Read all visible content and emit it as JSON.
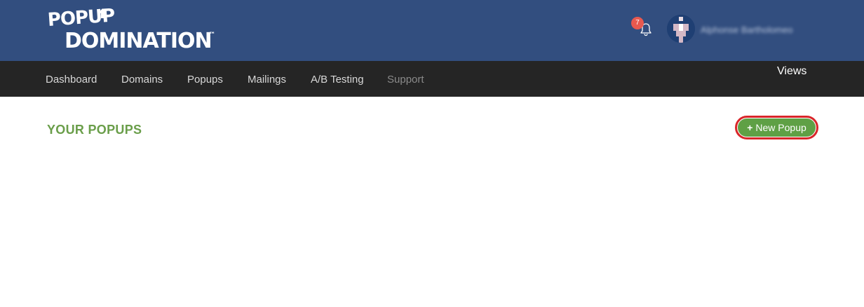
{
  "header": {
    "logo_line1": "POPUP",
    "logo_line2": "DOMINATION",
    "logo_tm": "™",
    "notification_count": "7",
    "user_name": "Alphonse Bartholomeo"
  },
  "nav": {
    "items": [
      {
        "label": "Dashboard"
      },
      {
        "label": "Domains"
      },
      {
        "label": "Popups"
      },
      {
        "label": "Mailings"
      },
      {
        "label": "A/B Testing"
      },
      {
        "label": "Support"
      }
    ],
    "views_label": "Views"
  },
  "main": {
    "title": "YOUR POPUPS",
    "new_button_label": "New Popup",
    "new_button_icon": "+"
  },
  "colors": {
    "header_bg": "#324e7f",
    "nav_bg": "#252525",
    "accent_green": "#6a9e4a",
    "button_green": "#5fa045",
    "highlight_red": "#d9262a",
    "badge_red": "#e8594f"
  },
  "icons": {
    "notifications": "bell-icon",
    "new_popup": "plus-icon"
  }
}
